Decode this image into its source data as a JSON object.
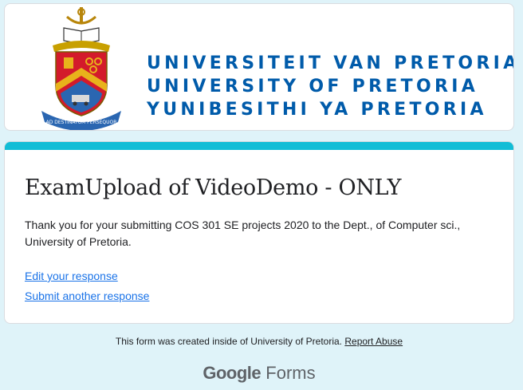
{
  "header": {
    "logo_icon": "university-crest",
    "logo_motto": "AD DESTINATUM PERSEQUOR",
    "name_lines": [
      "UNIVERSITEIT VAN PRETORIA",
      "UNIVERSITY OF PRETORIA",
      "YUNIBESITHI YA PRETORIA"
    ]
  },
  "form": {
    "title": "ExamUpload of VideoDemo - ONLY",
    "confirmation": "Thank you for your submitting COS 301  SE projects 2020 to the Dept., of Computer sci., University of Pretoria.",
    "edit_link": "Edit your response",
    "submit_another_link": "Submit another response"
  },
  "footer": {
    "created_text": "This form was created inside of University of Pretoria.",
    "report_link": "Report Abuse",
    "brand_google": "Google",
    "brand_forms": "Forms"
  },
  "colors": {
    "accent": "#12bdd6",
    "background": "#dff3f9",
    "link": "#1a73e8",
    "university_blue": "#005baa"
  }
}
